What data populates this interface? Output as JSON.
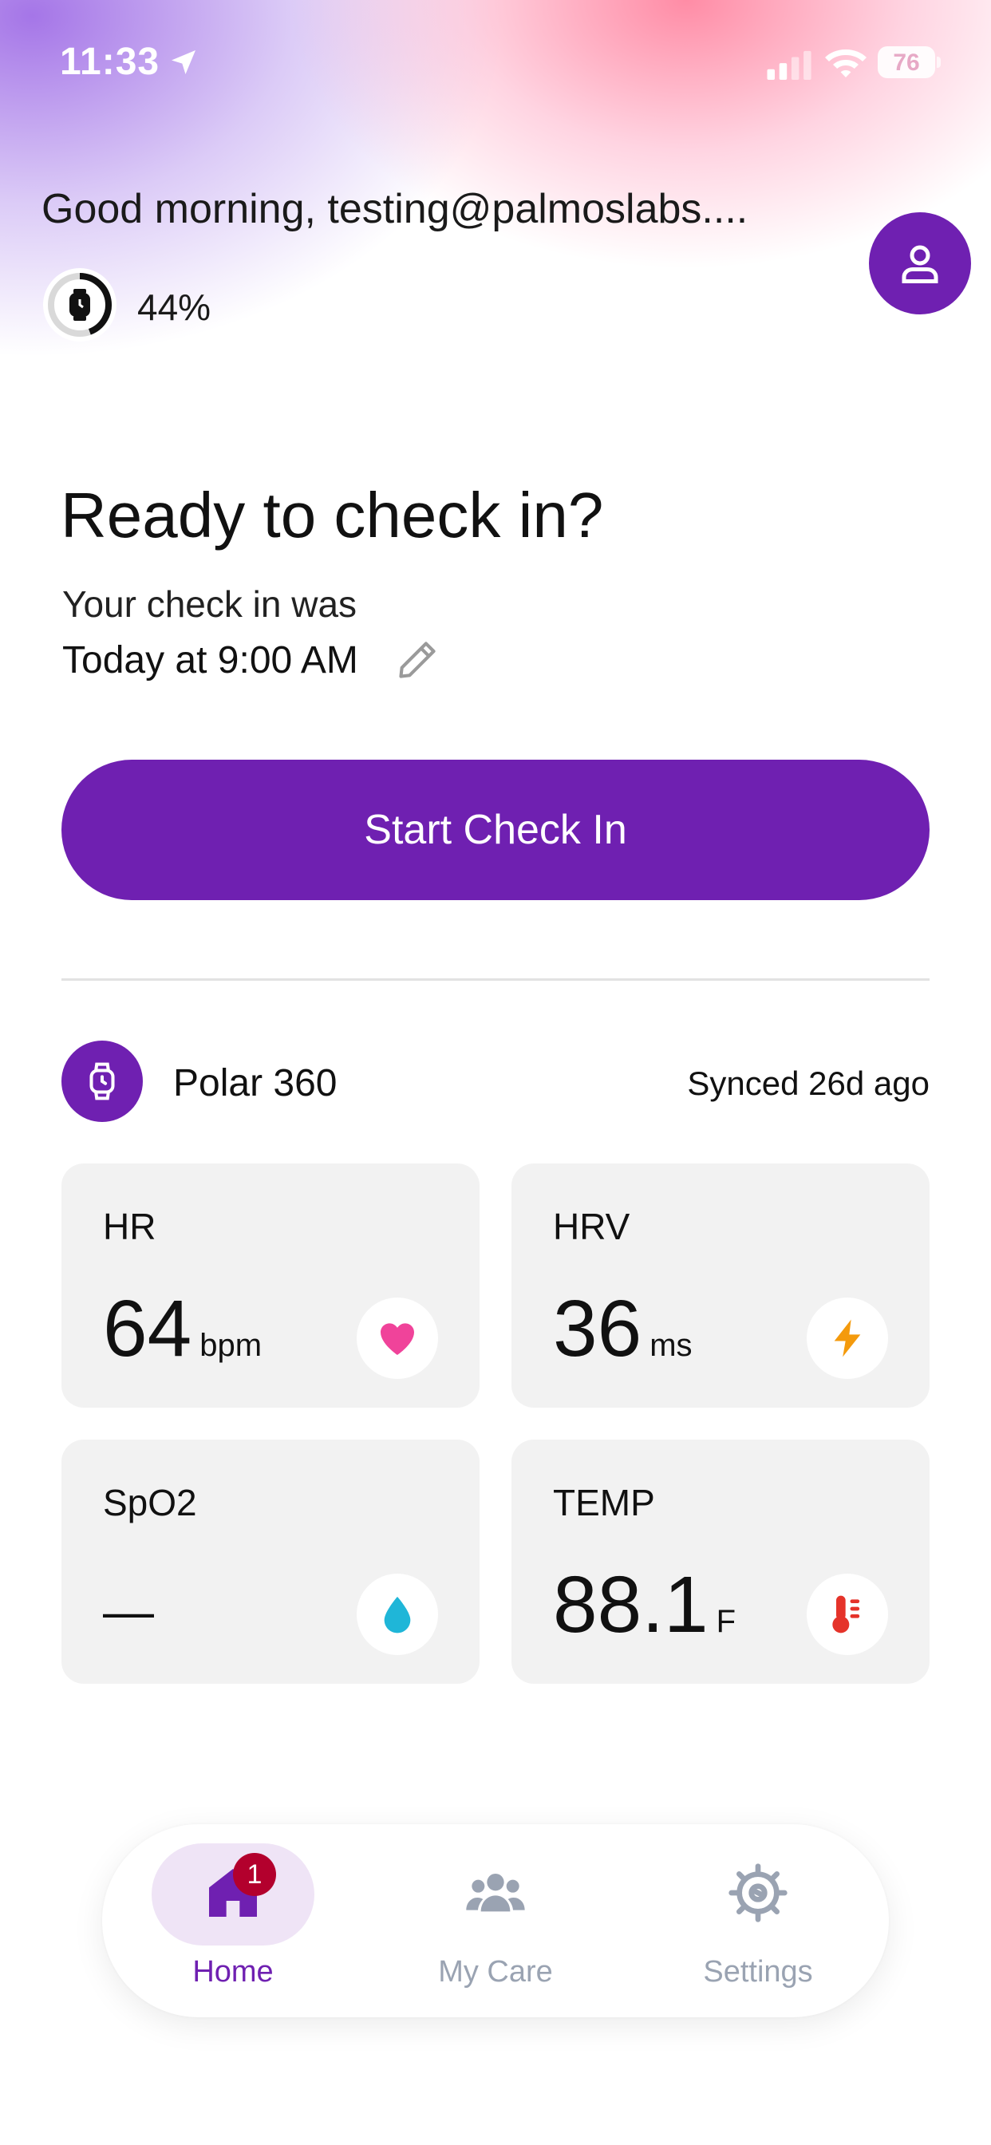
{
  "status_bar": {
    "time": "11:33",
    "battery": "76"
  },
  "header": {
    "greeting": "Good morning, testing@palmoslabs....",
    "device_battery": "44%"
  },
  "check_in": {
    "title": "Ready to check in?",
    "subtitle_line1": "Your check in was",
    "subtitle_line2": "Today at 9:00 AM",
    "button_label": "Start Check In"
  },
  "device": {
    "name": "Polar 360",
    "sync_status": "Synced 26d ago"
  },
  "metrics": [
    {
      "label": "HR",
      "value": "64",
      "unit": "bpm",
      "icon": "heart-icon",
      "color": "#f0439a"
    },
    {
      "label": "HRV",
      "value": "36",
      "unit": "ms",
      "icon": "lightning-icon",
      "color": "#f49a0c"
    },
    {
      "label": "SpO2",
      "value": "—",
      "unit": "",
      "icon": "droplet-icon",
      "color": "#1fb6d8"
    },
    {
      "label": "TEMP",
      "value": "88.1",
      "unit": "F",
      "icon": "thermometer-icon",
      "color": "#e5332a"
    }
  ],
  "nav": {
    "items": [
      {
        "label": "Home",
        "badge": "1",
        "active": true
      },
      {
        "label": "My Care",
        "active": false
      },
      {
        "label": "Settings",
        "active": false
      }
    ]
  },
  "colors": {
    "brand": "#6f20b1",
    "nav_inactive": "#9aa3b2"
  }
}
